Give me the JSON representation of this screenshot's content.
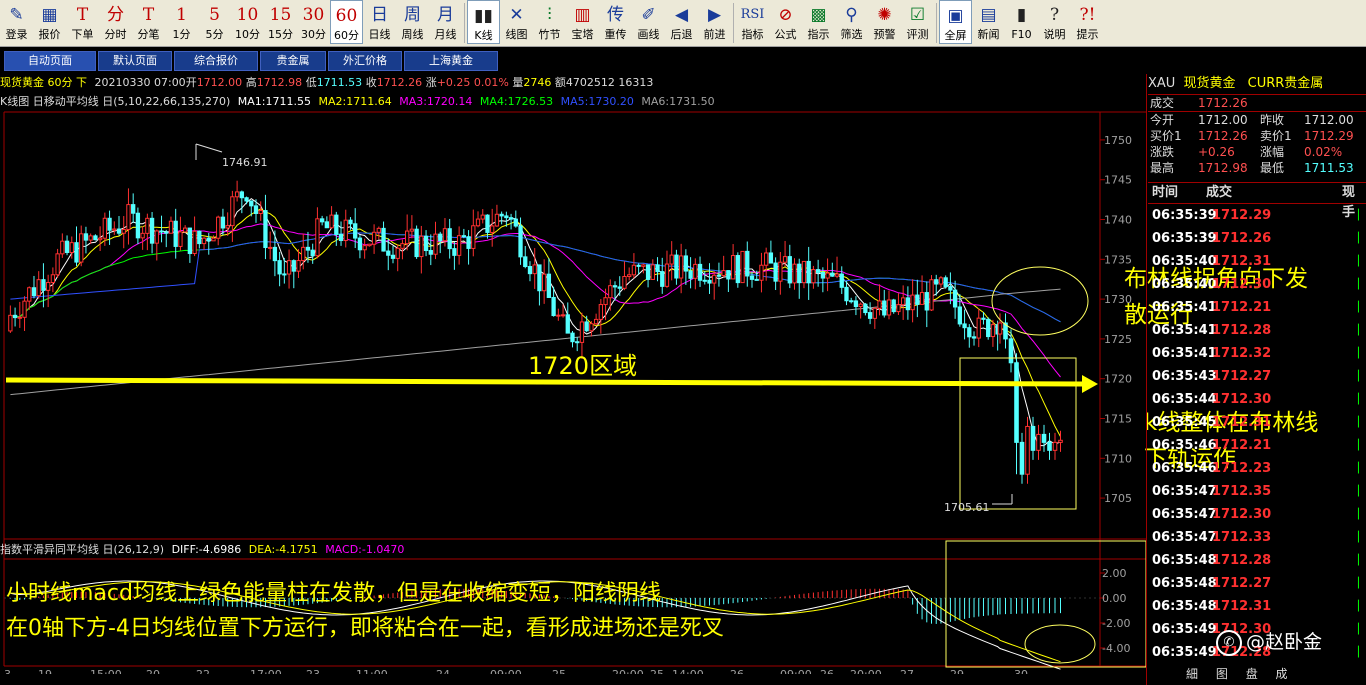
{
  "toolbar": {
    "items": [
      {
        "label": "登录",
        "icon": "pen-icon",
        "glyph": "✎",
        "color": "blue"
      },
      {
        "label": "报价",
        "icon": "grid-icon",
        "glyph": "▦",
        "color": "blue"
      },
      {
        "label": "下单",
        "icon": "order-icon",
        "glyph": "T",
        "color": "red"
      },
      {
        "label": "分时",
        "icon": "minute-icon",
        "glyph": "分",
        "color": "red"
      },
      {
        "label": "分笔",
        "icon": "tick-icon",
        "glyph": "T",
        "color": "red"
      },
      {
        "label": "1分",
        "icon": "1min-icon",
        "glyph": "1",
        "color": "red"
      },
      {
        "label": "5分",
        "icon": "5min-icon",
        "glyph": "5",
        "color": "red"
      },
      {
        "label": "10分",
        "icon": "10min-icon",
        "glyph": "10",
        "color": "red"
      },
      {
        "label": "15分",
        "icon": "15min-icon",
        "glyph": "15",
        "color": "red"
      },
      {
        "label": "30分",
        "icon": "30min-icon",
        "glyph": "30",
        "color": "red"
      },
      {
        "label": "60分",
        "icon": "60min-icon",
        "glyph": "60",
        "color": "red",
        "active": true
      },
      {
        "label": "日线",
        "icon": "day-icon",
        "glyph": "日",
        "color": "blue"
      },
      {
        "label": "周线",
        "icon": "week-icon",
        "glyph": "周",
        "color": "blue"
      },
      {
        "label": "月线",
        "icon": "month-icon",
        "glyph": "月",
        "color": "blue"
      },
      {
        "label": "K线",
        "icon": "kline-icon",
        "glyph": "▮▮",
        "color": "black",
        "active": true
      },
      {
        "label": "线图",
        "icon": "linechart-icon",
        "glyph": "✕",
        "color": "blue"
      },
      {
        "label": "竹节",
        "icon": "bamboo-icon",
        "glyph": "⫶",
        "color": "green"
      },
      {
        "label": "宝塔",
        "icon": "tower-icon",
        "glyph": "▥",
        "color": "red"
      },
      {
        "label": "重传",
        "icon": "reload-icon",
        "glyph": "传",
        "color": "blue"
      },
      {
        "label": "画线",
        "icon": "draw-icon",
        "glyph": "✐",
        "color": "blue"
      },
      {
        "label": "后退",
        "icon": "back-icon",
        "glyph": "◀",
        "color": "blue"
      },
      {
        "label": "前进",
        "icon": "forward-icon",
        "glyph": "▶",
        "color": "blue"
      },
      {
        "label": "指标",
        "icon": "indicator-icon",
        "glyph": "RSI",
        "color": "blue"
      },
      {
        "label": "公式",
        "icon": "formula-icon",
        "glyph": "⊘",
        "color": "red"
      },
      {
        "label": "指示",
        "icon": "signal-icon",
        "glyph": "▩",
        "color": "green"
      },
      {
        "label": "筛选",
        "icon": "binoculars-icon",
        "glyph": "⚲",
        "color": "blue"
      },
      {
        "label": "预警",
        "icon": "alarm-icon",
        "glyph": "✺",
        "color": "red"
      },
      {
        "label": "评测",
        "icon": "evaluate-icon",
        "glyph": "☑",
        "color": "green"
      },
      {
        "label": "全屏",
        "icon": "fullscreen-icon",
        "glyph": "▣",
        "color": "blue",
        "active": true
      },
      {
        "label": "新闻",
        "icon": "news-icon",
        "glyph": "▤",
        "color": "blue"
      },
      {
        "label": "F10",
        "icon": "f10-icon",
        "glyph": "▮",
        "color": "black"
      },
      {
        "label": "说明",
        "icon": "help-icon",
        "glyph": "?",
        "color": "black"
      },
      {
        "label": "提示",
        "icon": "tip-icon",
        "glyph": "?!",
        "color": "red"
      }
    ]
  },
  "tabs": [
    {
      "label": "自动页面",
      "active": true
    },
    {
      "label": "默认页面"
    },
    {
      "label": "综合报价"
    },
    {
      "label": "贵金属"
    },
    {
      "label": "外汇价格"
    },
    {
      "label": "上海黄金"
    }
  ],
  "title": {
    "symbol": "现货黄金 60分 下",
    "date": "20210330 07:00",
    "open_label": "开",
    "open": "1712.00",
    "high_label": "高",
    "high": "1712.98",
    "low_label": "低",
    "low": "1711.53",
    "close_label": "收",
    "close": "1712.26",
    "change_label": "涨",
    "change": "+0.25",
    "change_pct": "0.01%",
    "volume_label": "量",
    "volume": "2746",
    "oi_label": "额",
    "oi": "4702512 16313"
  },
  "ma_bar": {
    "name": "K线图 日移动平均线 日(5,10,22,66,135,270)",
    "ma1": "MA1:1711.55",
    "ma2": "MA2:1711.64",
    "ma3": "MA3:1720.14",
    "ma4": "MA4:1726.53",
    "ma5": "MA5:1730.20",
    "ma6": "MA6:1731.50"
  },
  "macd_bar": {
    "name": "指数平滑异同平均线 日(26,12,9)",
    "diff": "DIFF:-4.6986",
    "dea": "DEA:-4.1751",
    "macd": "MACD:-1.0470"
  },
  "price_axis": [
    "1750",
    "1745",
    "1740",
    "1735",
    "1730",
    "1725",
    "1720",
    "1715",
    "1710",
    "1705"
  ],
  "macd_axis": [
    "2.00",
    "0.00",
    "-2.00",
    "-4.00"
  ],
  "time_axis": [
    "3",
    "19",
    "15:00",
    "20",
    "22",
    "17:00",
    "23",
    "11:00",
    "24",
    "09:00",
    "25",
    "20:00",
    "25",
    "14:00",
    "26",
    "09:00",
    "26",
    "20:00",
    "27",
    "29",
    "30"
  ],
  "chart_labels": {
    "peak": "1746.91",
    "trough": "1705.61"
  },
  "annotations": {
    "zone": "1720区域",
    "boll_turn_1": "布林线拐角向下发",
    "boll_turn_2": "散运行",
    "kline_1": "k线整体在布林线",
    "kline_2": "下轨运作",
    "macd_1": "小时线macd均线上绿色能量柱在发散，但是在收缩变短，阳线阴线",
    "macd_2": "在0轴下方-4日均线位置下方运行，即将粘合在一起，看形成进场还是死叉"
  },
  "quote": {
    "code": "XAU",
    "name": "现货黄金",
    "market": "CURR贵金属",
    "last_label": "成交",
    "last": "1712.26",
    "open_label": "今开",
    "open": "1712.00",
    "prev_label": "昨收",
    "prev": "1712.00",
    "bid_label": "买价1",
    "bid": "1712.26",
    "ask_label": "卖价1",
    "ask": "1712.29",
    "chg_label": "涨跌",
    "chg": "+0.26",
    "pct_label": "涨幅",
    "pct": "0.02%",
    "high_label": "最高",
    "high": "1712.98",
    "low_label": "最低",
    "low": "1711.53"
  },
  "ticks_header": {
    "time": "时间",
    "price": "成交",
    "vol": "现手"
  },
  "ticks": [
    {
      "time": "06:35:39",
      "price": "1712.29"
    },
    {
      "time": "06:35:39",
      "price": "1712.26"
    },
    {
      "time": "06:35:40",
      "price": "1712.31"
    },
    {
      "time": "06:35:40",
      "price": "1712.30"
    },
    {
      "time": "06:35:41",
      "price": "1712.21"
    },
    {
      "time": "06:35:41",
      "price": "1712.28"
    },
    {
      "time": "06:35:41",
      "price": "1712.32"
    },
    {
      "time": "06:35:43",
      "price": "1712.27"
    },
    {
      "time": "06:35:44",
      "price": "1712.30"
    },
    {
      "time": "06:35:45",
      "price": "1712.31"
    },
    {
      "time": "06:35:46",
      "price": "1712.21"
    },
    {
      "time": "06:35:46",
      "price": "1712.23"
    },
    {
      "time": "06:35:47",
      "price": "1712.35"
    },
    {
      "time": "06:35:47",
      "price": "1712.30"
    },
    {
      "time": "06:35:47",
      "price": "1712.33"
    },
    {
      "time": "06:35:48",
      "price": "1712.28"
    },
    {
      "time": "06:35:48",
      "price": "1712.27"
    },
    {
      "time": "06:35:48",
      "price": "1712.31"
    },
    {
      "time": "06:35:49",
      "price": "1712.30"
    },
    {
      "time": "06:35:49",
      "price": "1712.28"
    }
  ],
  "watermark": "@赵卧金",
  "footer_tabs": [
    "細",
    "图",
    "盘",
    "成"
  ],
  "colors": {
    "up": "#ff3030",
    "down": "#54ffff",
    "ma1": "#ffffff",
    "ma2": "#ffff00",
    "ma3": "#ff00ff",
    "ma4": "#00ff00",
    "ma5": "#3050ff",
    "ma6": "#a0a0a0",
    "annotation": "#ffff00"
  }
}
